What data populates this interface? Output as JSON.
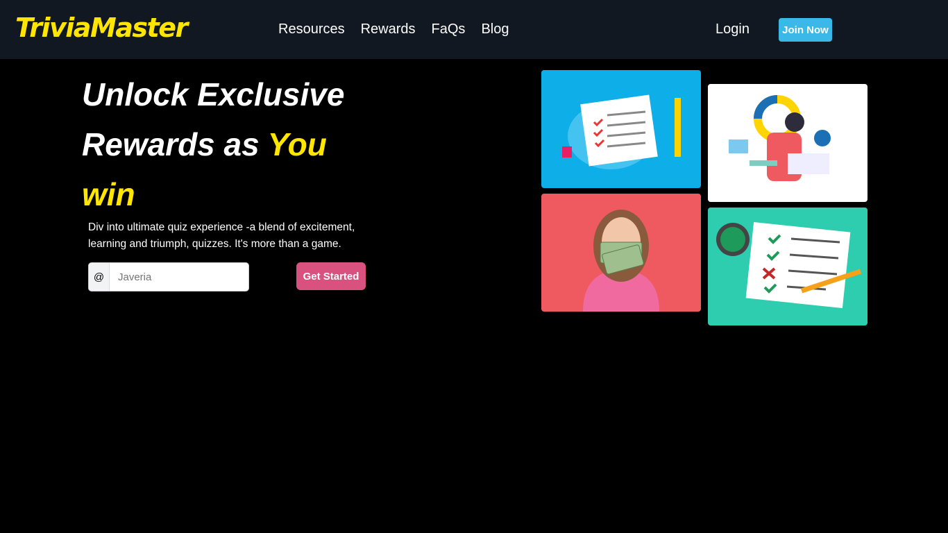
{
  "nav": {
    "logo": "TriviaMaster",
    "links": [
      "Resources",
      "Rewards",
      "FaQs",
      "Blog"
    ],
    "login": "Login",
    "join": "Join Now"
  },
  "hero": {
    "title_part1": "Unlock Exclusive Rewards as ",
    "title_highlight": "You win",
    "description": "Div into ultimate quiz experience -a blend of excitement, learning and triumph, quizzes. It's more than a game.",
    "input_prefix": "@",
    "input_placeholder": "Javeria",
    "cta": "Get Started"
  },
  "colors": {
    "accent": "#ffe500",
    "cta": "#d9527f",
    "join": "#3ab8e8"
  }
}
